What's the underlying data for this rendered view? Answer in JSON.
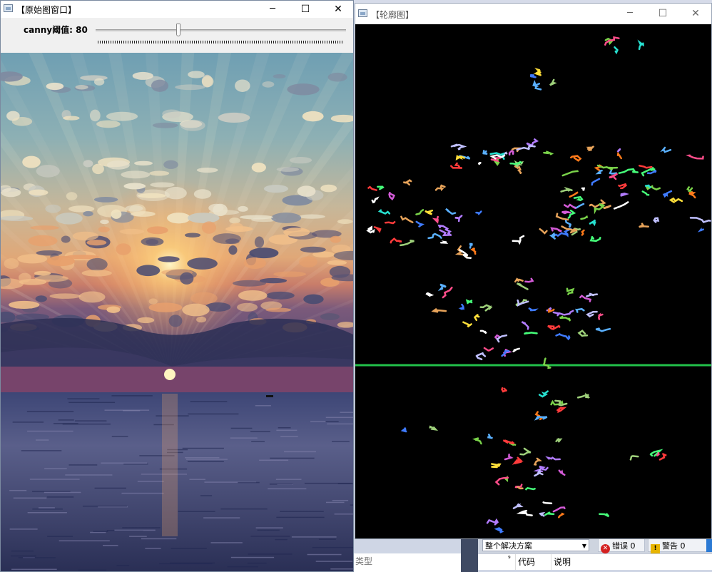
{
  "original_window": {
    "title": "【原始图窗口】",
    "buttons": {
      "minimize": "─",
      "maximize": "☐",
      "close": "✕"
    },
    "trackbar": {
      "label": "canny阈值: 80",
      "value": 80,
      "fill_fraction": 0.33
    }
  },
  "contour_window": {
    "title": "【轮廓图】",
    "buttons": {
      "minimize": "─",
      "maximize": "☐",
      "close": "✕"
    }
  },
  "vs": {
    "scope": "整个解决方案",
    "errors": "错误 0",
    "warnings": "警告 0",
    "col_code": "代码",
    "col_desc": "说明",
    "col_type": "类型"
  },
  "colors": {
    "accent": "#1a7f37",
    "error": "#d42020",
    "warning": "#e7b400"
  }
}
